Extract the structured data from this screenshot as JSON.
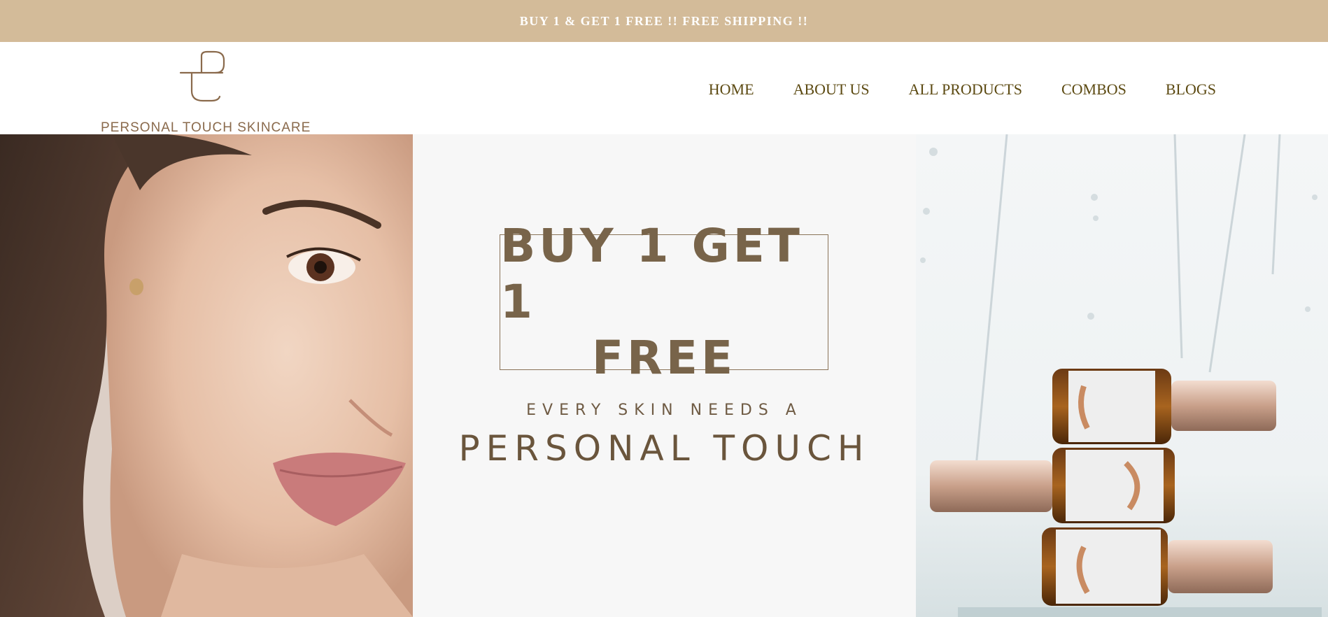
{
  "announcement": {
    "text": "BUY 1 & GET 1 FREE !! FREE SHIPPING !!"
  },
  "brand": {
    "name": "PERSONAL TOUCH SKINCARE",
    "logo_icon": "pt-monogram-icon"
  },
  "nav": {
    "items": [
      {
        "label": "HOME"
      },
      {
        "label": "ABOUT US"
      },
      {
        "label": "ALL PRODUCTS"
      },
      {
        "label": "COMBOS"
      },
      {
        "label": "BLOGS"
      }
    ]
  },
  "hero": {
    "offer_line1": "BUY 1 GET 1",
    "offer_line2": "FREE",
    "tagline_small": "EVERY SKIN NEEDS A",
    "tagline_big": "PERSONAL TOUCH"
  },
  "colors": {
    "announcement_bg": "#d3bb99",
    "nav_text": "#5c4a12",
    "brand_brown": "#78644a"
  }
}
